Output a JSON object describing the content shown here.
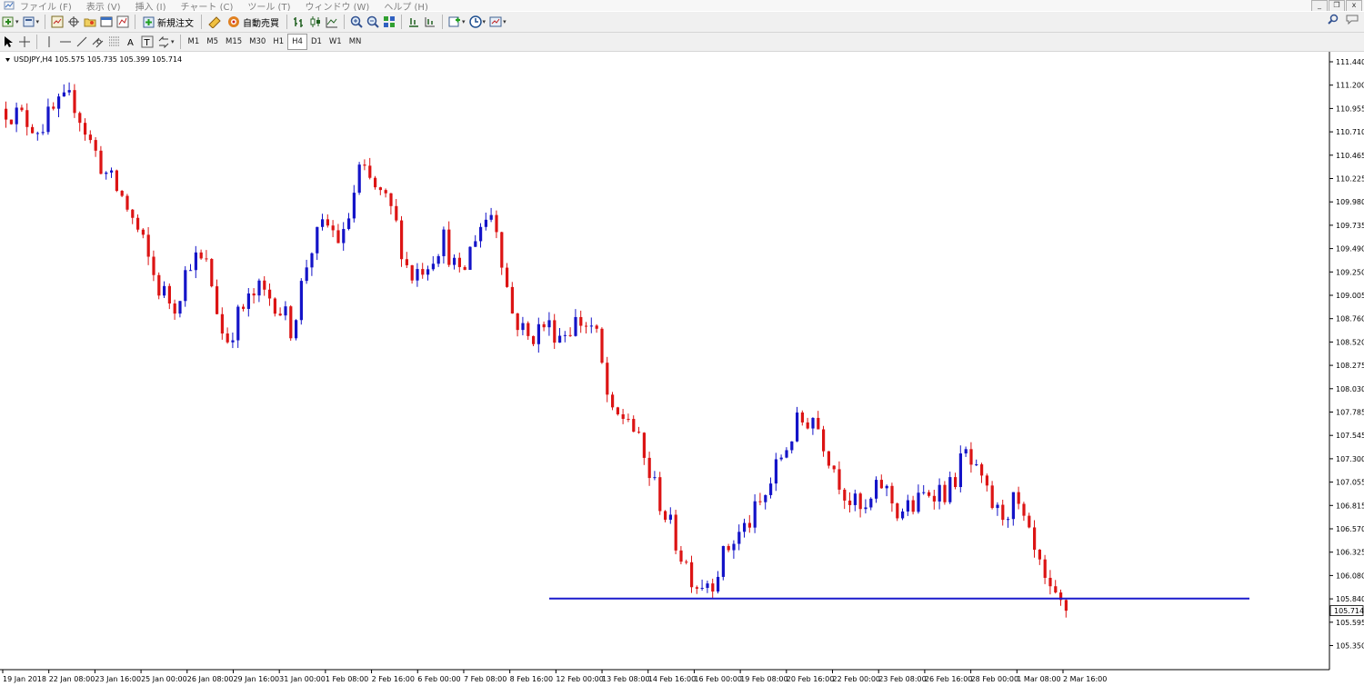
{
  "menu": {
    "items": [
      "ファイル (F)",
      "表示 (V)",
      "挿入 (I)",
      "チャート (C)",
      "ツール (T)",
      "ウィンドウ (W)",
      "ヘルプ (H)"
    ],
    "window_controls": [
      "_",
      "❐",
      "x"
    ]
  },
  "toolbar": {
    "new_order_label": "新規注文",
    "auto_trading_label": "自動売買"
  },
  "timeframes": [
    "M1",
    "M5",
    "M15",
    "M30",
    "H1",
    "H4",
    "D1",
    "W1",
    "MN"
  ],
  "active_timeframe": "H4",
  "chart": {
    "symbol_info": "USDJPY,H4  105.575 105.735 105.399 105.714",
    "current_price": "105.714",
    "horizontal_line_price": 105.84,
    "colors": {
      "up": "#1414c8",
      "down": "#dc1414",
      "line": "#1a1acc",
      "price_tag_bg": "#ffffff"
    }
  },
  "chart_data": {
    "type": "candlestick",
    "price_ticks": [
      "111.440",
      "111.200",
      "110.955",
      "110.710",
      "110.465",
      "110.225",
      "109.980",
      "109.735",
      "109.490",
      "109.250",
      "109.005",
      "108.760",
      "108.520",
      "108.275",
      "108.030",
      "107.785",
      "107.545",
      "107.300",
      "107.055",
      "106.815",
      "106.570",
      "106.325",
      "106.080",
      "105.840",
      "105.595",
      "105.350"
    ],
    "time_labels": [
      "19 Jan 2018",
      "22 Jan 08:00",
      "23 Jan 16:00",
      "25 Jan 00:00",
      "26 Jan 08:00",
      "29 Jan 16:00",
      "31 Jan 00:00",
      "1 Feb 08:00",
      "2 Feb 16:00",
      "6 Feb 00:00",
      "7 Feb 08:00",
      "8 Feb 16:00",
      "12 Feb 00:00",
      "13 Feb 08:00",
      "14 Feb 16:00",
      "16 Feb 00:00",
      "19 Feb 08:00",
      "20 Feb 16:00",
      "22 Feb 00:00",
      "23 Feb 08:00",
      "26 Feb 16:00",
      "28 Feb 00:00",
      "1 Mar 08:00",
      "2 Mar 16:00"
    ],
    "close_path": [
      110.95,
      110.85,
      110.75,
      110.95,
      111.05,
      110.6,
      110.25,
      110.0,
      109.6,
      109.1,
      108.9,
      109.4,
      109.3,
      108.5,
      108.85,
      109.05,
      108.95,
      108.65,
      109.45,
      109.75,
      109.55,
      110.3,
      110.1,
      109.85,
      109.2,
      109.35,
      109.6,
      109.15,
      109.7,
      109.9,
      108.85,
      108.55,
      108.7,
      108.6,
      108.75,
      108.65,
      107.7,
      107.75,
      107.25,
      106.8,
      106.35,
      106.0,
      106.05,
      106.4,
      106.6,
      106.85,
      107.3,
      107.65,
      107.75,
      107.3,
      106.9,
      106.7,
      107.05,
      106.75,
      106.8,
      107.0,
      106.95,
      107.35,
      107.0,
      106.7,
      106.85,
      106.35,
      105.85,
      105.72
    ],
    "horizontal_line": 105.84,
    "last_price": 105.714,
    "ylim": [
      105.2,
      111.55
    ]
  }
}
